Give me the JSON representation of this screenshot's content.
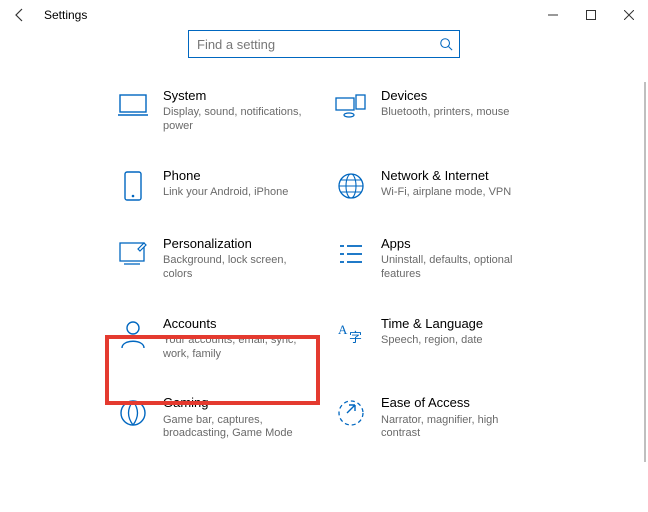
{
  "window": {
    "title": "Settings"
  },
  "search": {
    "placeholder": "Find a setting"
  },
  "categories": [
    {
      "id": "system",
      "title": "System",
      "subtitle": "Display, sound, notifications, power"
    },
    {
      "id": "devices",
      "title": "Devices",
      "subtitle": "Bluetooth, printers, mouse"
    },
    {
      "id": "phone",
      "title": "Phone",
      "subtitle": "Link your Android, iPhone"
    },
    {
      "id": "network",
      "title": "Network & Internet",
      "subtitle": "Wi-Fi, airplane mode, VPN"
    },
    {
      "id": "personalization",
      "title": "Personalization",
      "subtitle": "Background, lock screen, colors"
    },
    {
      "id": "apps",
      "title": "Apps",
      "subtitle": "Uninstall, defaults, optional features"
    },
    {
      "id": "accounts",
      "title": "Accounts",
      "subtitle": "Your accounts, email, sync, work, family"
    },
    {
      "id": "timelang",
      "title": "Time & Language",
      "subtitle": "Speech, region, date"
    },
    {
      "id": "gaming",
      "title": "Gaming",
      "subtitle": "Game bar, captures, broadcasting, Game Mode"
    },
    {
      "id": "ease",
      "title": "Ease of Access",
      "subtitle": "Narrator, magnifier, high contrast"
    }
  ],
  "highlight": {
    "target": "accounts"
  }
}
